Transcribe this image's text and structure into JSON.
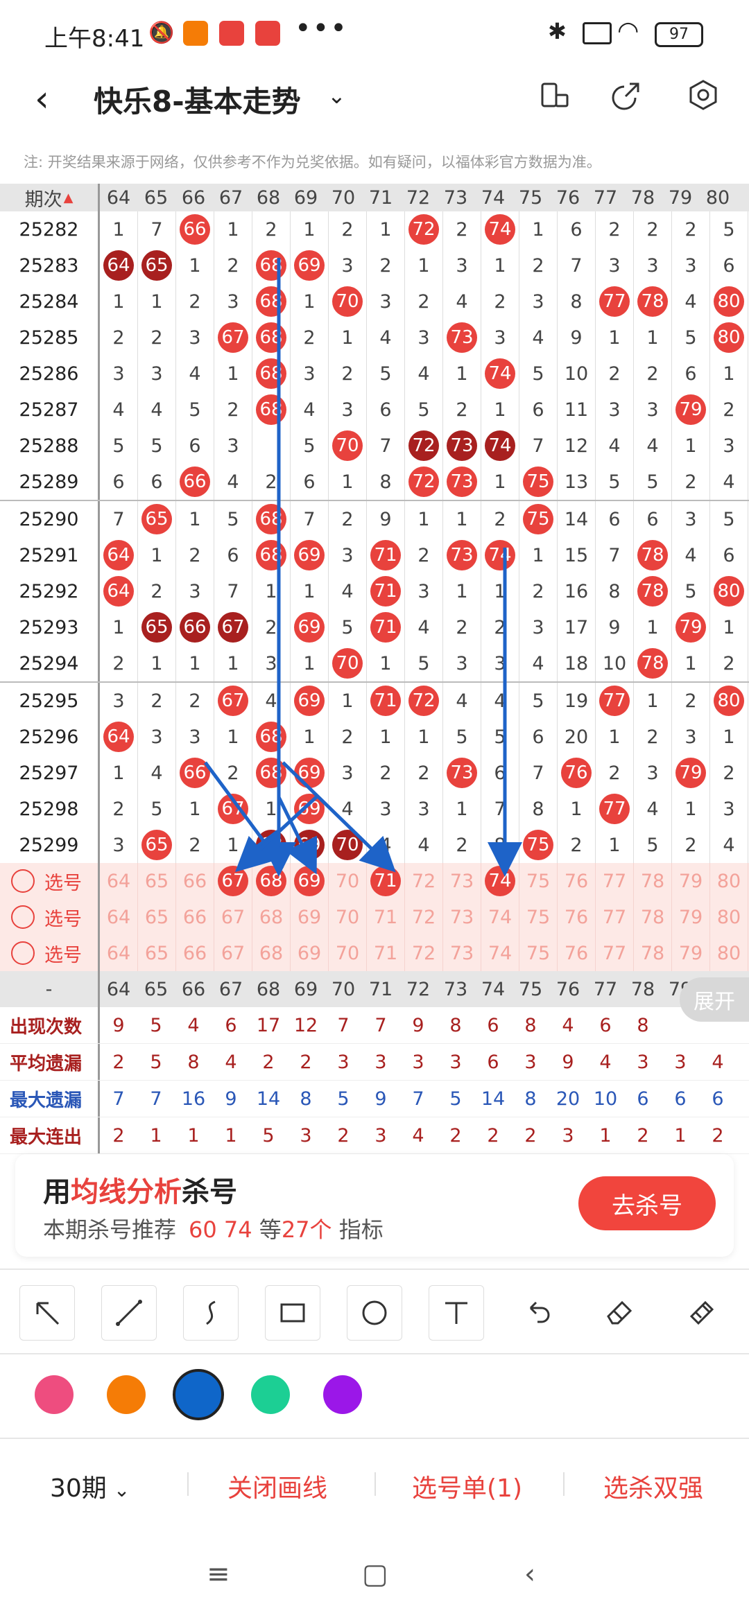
{
  "status": {
    "time": "上午8:41",
    "battery": "97"
  },
  "header": {
    "title": "快乐8-基本走势"
  },
  "notice": "注: 开奖结果来源于网络，仅供参考不作为兑奖依据。如有疑问，以福体彩官方数据为准。",
  "grid": {
    "head_label": "期次",
    "columns": [
      "64",
      "65",
      "66",
      "67",
      "68",
      "69",
      "70",
      "71",
      "72",
      "73",
      "74",
      "75",
      "76",
      "77",
      "78",
      "79",
      "80"
    ],
    "rows": [
      {
        "id": "25282",
        "cells": [
          "1",
          "7",
          "66",
          "1",
          "2",
          "1",
          "2",
          "1",
          "72",
          "2",
          "74",
          "1",
          "6",
          "2",
          "2",
          "2",
          "5"
        ],
        "hits": [
          2,
          8,
          10
        ]
      },
      {
        "id": "25283",
        "cells": [
          "64",
          "65",
          "1",
          "2",
          "68",
          "69",
          "3",
          "2",
          "1",
          "3",
          "1",
          "2",
          "7",
          "3",
          "3",
          "3",
          "6"
        ],
        "hits": [
          0,
          1,
          4,
          5
        ],
        "dark": [
          0,
          1
        ]
      },
      {
        "id": "25284",
        "cells": [
          "1",
          "1",
          "2",
          "3",
          "68",
          "1",
          "70",
          "3",
          "2",
          "4",
          "2",
          "3",
          "8",
          "77",
          "78",
          "4",
          "80"
        ],
        "hits": [
          4,
          6,
          13,
          14,
          16
        ]
      },
      {
        "id": "25285",
        "cells": [
          "2",
          "2",
          "3",
          "67",
          "68",
          "2",
          "1",
          "4",
          "3",
          "73",
          "3",
          "4",
          "9",
          "1",
          "1",
          "5",
          "80"
        ],
        "hits": [
          3,
          4,
          9,
          16
        ]
      },
      {
        "id": "25286",
        "cells": [
          "3",
          "3",
          "4",
          "1",
          "68",
          "3",
          "2",
          "5",
          "4",
          "1",
          "74",
          "5",
          "10",
          "2",
          "2",
          "6",
          "1"
        ],
        "hits": [
          4,
          10
        ]
      },
      {
        "id": "25287",
        "cells": [
          "4",
          "4",
          "5",
          "2",
          "68",
          "4",
          "3",
          "6",
          "5",
          "2",
          "1",
          "6",
          "11",
          "3",
          "3",
          "79",
          "2"
        ],
        "hits": [
          4,
          15
        ]
      },
      {
        "id": "25288",
        "cells": [
          "5",
          "5",
          "6",
          "3",
          "",
          "5",
          "70",
          "7",
          "72",
          "73",
          "74",
          "7",
          "12",
          "4",
          "4",
          "1",
          "3"
        ],
        "hits": [
          6,
          8,
          9,
          10
        ],
        "dark": [
          8,
          9,
          10
        ]
      },
      {
        "id": "25289",
        "cells": [
          "6",
          "6",
          "66",
          "4",
          "2",
          "6",
          "1",
          "8",
          "72",
          "73",
          "1",
          "75",
          "13",
          "5",
          "5",
          "2",
          "4"
        ],
        "hits": [
          2,
          8,
          9,
          11
        ]
      },
      {
        "id": "25290",
        "cells": [
          "7",
          "65",
          "1",
          "5",
          "68",
          "7",
          "2",
          "9",
          "1",
          "1",
          "2",
          "75",
          "14",
          "6",
          "6",
          "3",
          "5"
        ],
        "hits": [
          1,
          4,
          11
        ]
      },
      {
        "id": "25291",
        "cells": [
          "64",
          "1",
          "2",
          "6",
          "68",
          "69",
          "3",
          "71",
          "2",
          "73",
          "74",
          "1",
          "15",
          "7",
          "78",
          "4",
          "6"
        ],
        "hits": [
          0,
          4,
          5,
          7,
          9,
          10,
          14
        ]
      },
      {
        "id": "25292",
        "cells": [
          "64",
          "2",
          "3",
          "7",
          "1",
          "1",
          "4",
          "71",
          "3",
          "1",
          "1",
          "2",
          "16",
          "8",
          "78",
          "5",
          "80"
        ],
        "hits": [
          0,
          7,
          14,
          16
        ]
      },
      {
        "id": "25293",
        "cells": [
          "1",
          "65",
          "66",
          "67",
          "2",
          "69",
          "5",
          "71",
          "4",
          "2",
          "2",
          "3",
          "17",
          "9",
          "1",
          "79",
          "1"
        ],
        "hits": [
          1,
          2,
          3,
          5,
          7,
          15
        ],
        "dark": [
          1,
          2,
          3
        ]
      },
      {
        "id": "25294",
        "cells": [
          "2",
          "1",
          "1",
          "1",
          "3",
          "1",
          "70",
          "1",
          "5",
          "3",
          "3",
          "4",
          "18",
          "10",
          "78",
          "1",
          "2"
        ],
        "hits": [
          6,
          14
        ]
      },
      {
        "id": "25295",
        "cells": [
          "3",
          "2",
          "2",
          "67",
          "4",
          "69",
          "1",
          "71",
          "72",
          "4",
          "4",
          "5",
          "19",
          "77",
          "1",
          "2",
          "80"
        ],
        "hits": [
          3,
          5,
          7,
          8,
          13,
          16
        ]
      },
      {
        "id": "25296",
        "cells": [
          "64",
          "3",
          "3",
          "1",
          "68",
          "1",
          "2",
          "1",
          "1",
          "5",
          "5",
          "6",
          "20",
          "1",
          "2",
          "3",
          "1"
        ],
        "hits": [
          0,
          4
        ]
      },
      {
        "id": "25297",
        "cells": [
          "1",
          "4",
          "66",
          "2",
          "68",
          "69",
          "3",
          "2",
          "2",
          "73",
          "6",
          "7",
          "76",
          "2",
          "3",
          "79",
          "2"
        ],
        "hits": [
          2,
          4,
          5,
          9,
          12,
          15
        ]
      },
      {
        "id": "25298",
        "cells": [
          "2",
          "5",
          "1",
          "67",
          "1",
          "69",
          "4",
          "3",
          "3",
          "1",
          "7",
          "8",
          "1",
          "77",
          "4",
          "1",
          "3"
        ],
        "hits": [
          3,
          5,
          13
        ]
      },
      {
        "id": "25299",
        "cells": [
          "3",
          "65",
          "2",
          "1",
          "68",
          "69",
          "70",
          "4",
          "4",
          "2",
          "8",
          "75",
          "2",
          "1",
          "5",
          "2",
          "4"
        ],
        "hits": [
          1,
          4,
          5,
          6,
          11
        ],
        "dark": [
          4,
          5,
          6
        ]
      }
    ],
    "pick_label": "选号",
    "pick_selected": [
      [
        3,
        4,
        5,
        7,
        10
      ],
      [],
      []
    ],
    "dash_label": "-",
    "stats": [
      {
        "label": "出现次数",
        "values": [
          "9",
          "5",
          "4",
          "6",
          "17",
          "12",
          "7",
          "7",
          "9",
          "8",
          "6",
          "8",
          "4",
          "6",
          "8",
          "",
          ""
        ],
        "color": "red"
      },
      {
        "label": "平均遗漏",
        "values": [
          "2",
          "5",
          "8",
          "4",
          "2",
          "2",
          "3",
          "3",
          "3",
          "3",
          "6",
          "3",
          "9",
          "4",
          "3",
          "3",
          "4"
        ],
        "color": "red"
      },
      {
        "label": "最大遗漏",
        "values": [
          "7",
          "7",
          "16",
          "9",
          "14",
          "8",
          "5",
          "9",
          "7",
          "5",
          "14",
          "8",
          "20",
          "10",
          "6",
          "6",
          "6"
        ],
        "color": "blue"
      },
      {
        "label": "最大连出",
        "values": [
          "2",
          "1",
          "1",
          "1",
          "5",
          "3",
          "2",
          "3",
          "4",
          "2",
          "2",
          "2",
          "3",
          "1",
          "2",
          "1",
          "2"
        ],
        "color": "red"
      }
    ],
    "expand": "展开"
  },
  "promo": {
    "title_pre": "用",
    "title_hl": "均线分析",
    "title_post": "杀号",
    "sub_pre": "本期杀号推荐",
    "sub_nums": "60 74",
    "sub_mid": " 等",
    "sub_cnt": "27个",
    "sub_post": " 指标",
    "button": "去杀号"
  },
  "colors": [
    "#ee4d7f",
    "#f57c06",
    "#0f66c9",
    "#1ccf94",
    "#9b17e8"
  ],
  "bottom": {
    "period": "30期",
    "close": "关闭画线",
    "picklist": "选号单(1)",
    "kill": "选杀双强"
  },
  "accent": "#e8423d",
  "dark_ball": "#a8201f",
  "arrow_color": "#1e63c8"
}
